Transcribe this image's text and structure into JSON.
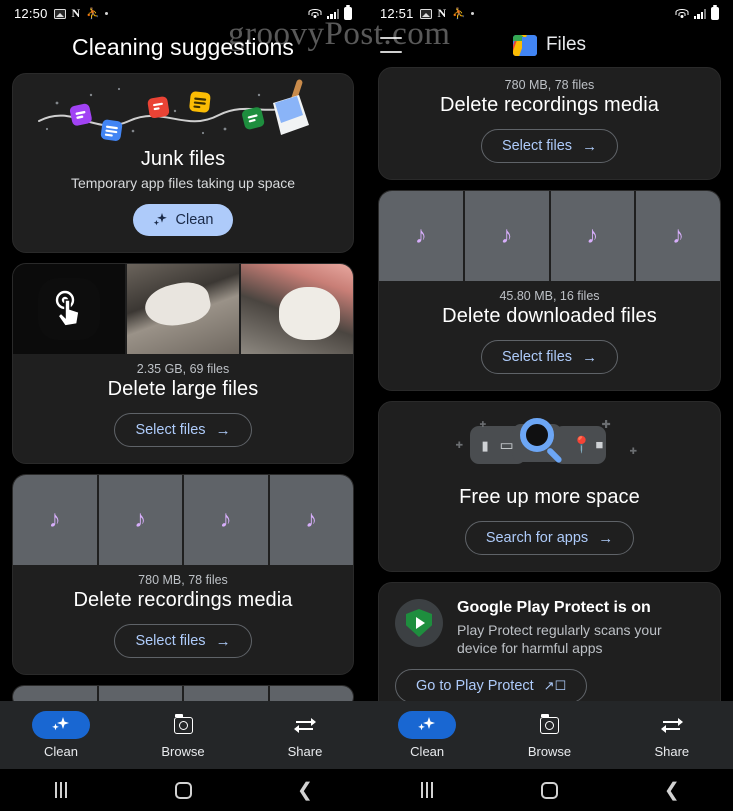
{
  "meta": {
    "watermark": "groovyPost.com",
    "accent_blue": "#AECBFA",
    "nav_active_blue": "#1967D2",
    "card_bg": "#1f1f1f",
    "note_purple": "#D7AEFB"
  },
  "left_phone": {
    "statusbar": {
      "time": "12:50",
      "icons": [
        "photo-icon",
        "netflix-icon",
        "gmail-icon",
        "dot-icon"
      ],
      "right_icons": [
        "wifi-icon",
        "signal-icon",
        "battery-icon"
      ]
    },
    "page_title": "Cleaning suggestions",
    "cards": [
      {
        "id": "junk-files",
        "illustration": "broom-sweeping-files-icon",
        "title": "Junk files",
        "subtitle": "Temporary app files taking up space",
        "button": {
          "label": "Clean",
          "style": "filled",
          "icon": "sparkle-icon"
        }
      },
      {
        "id": "delete-large-files",
        "thumbnails": [
          "touch-app-icon",
          "dog-photo",
          "dog-photo-2"
        ],
        "meta": "2.35 GB, 69 files",
        "title": "Delete large files",
        "button": {
          "label": "Select files",
          "style": "outline",
          "icon": "arrow-right-icon"
        }
      },
      {
        "id": "delete-recordings-media",
        "thumbnails": [
          "music-note-icon",
          "music-note-icon",
          "music-note-icon",
          "music-note-icon"
        ],
        "meta": "780 MB, 78 files",
        "title": "Delete recordings media",
        "button": {
          "label": "Select files",
          "style": "outline",
          "icon": "arrow-right-icon"
        }
      }
    ],
    "bottom_nav": [
      {
        "label": "Clean",
        "icon": "sparkle-icon",
        "active": true
      },
      {
        "label": "Browse",
        "icon": "folder-search-icon",
        "active": false
      },
      {
        "label": "Share",
        "icon": "share-transfer-icon",
        "active": false
      }
    ],
    "android_nav": [
      "recents-button",
      "home-button",
      "back-button"
    ]
  },
  "right_phone": {
    "statusbar": {
      "time": "12:51",
      "icons": [
        "photo-icon",
        "netflix-icon",
        "gmail-icon",
        "dot-icon"
      ],
      "right_icons": [
        "wifi-icon",
        "signal-icon",
        "battery-icon"
      ]
    },
    "app_header": {
      "menu_icon": "hamburger-menu-icon",
      "logo": "files-logo-icon",
      "app_name": "Files"
    },
    "cards": [
      {
        "id": "delete-recordings-media",
        "meta": "780 MB, 78 files",
        "title": "Delete recordings media",
        "button": {
          "label": "Select files",
          "style": "outline",
          "icon": "arrow-right-icon"
        }
      },
      {
        "id": "delete-downloaded-files",
        "thumbnails": [
          "music-note-icon",
          "music-note-icon",
          "music-note-icon",
          "music-note-icon"
        ],
        "meta": "45.80 MB, 16 files",
        "title": "Delete downloaded files",
        "button": {
          "label": "Select files",
          "style": "outline",
          "icon": "arrow-right-icon"
        }
      },
      {
        "id": "free-up-more-space",
        "illustration": "magnifier-apps-search-icon",
        "title": "Free up more space",
        "button": {
          "label": "Search for apps",
          "style": "outline",
          "icon": "arrow-right-icon"
        }
      },
      {
        "id": "google-play-protect",
        "icon": "play-protect-shield-icon",
        "title": "Google Play Protect is on",
        "subtitle": "Play Protect regularly scans your device for harmful apps",
        "button": {
          "label": "Go to Play Protect",
          "style": "outline",
          "icon": "external-link-icon"
        }
      }
    ],
    "bottom_nav": [
      {
        "label": "Clean",
        "icon": "sparkle-icon",
        "active": true
      },
      {
        "label": "Browse",
        "icon": "folder-search-icon",
        "active": false
      },
      {
        "label": "Share",
        "icon": "share-transfer-icon",
        "active": false
      }
    ],
    "android_nav": [
      "recents-button",
      "home-button",
      "back-button"
    ]
  }
}
